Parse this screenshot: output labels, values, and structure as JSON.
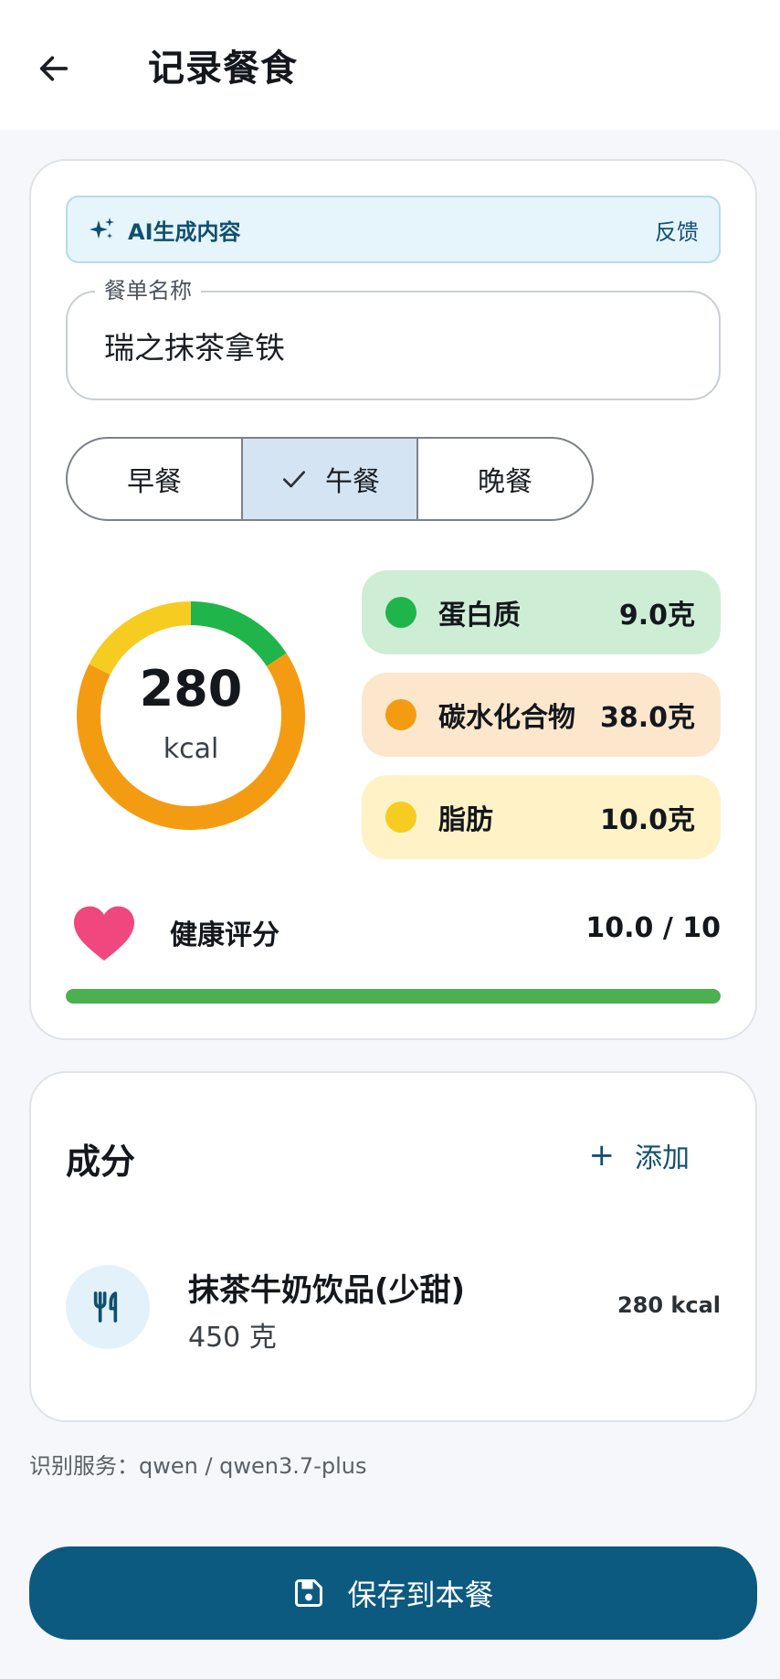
{
  "header": {
    "title": "记录餐食",
    "back_icon": "arrow-left-icon"
  },
  "ai_banner": {
    "label": "AI生成内容",
    "feedback": "反馈",
    "icon": "sparkle-icon"
  },
  "meal_name": {
    "legend": "餐单名称",
    "value": "瑞之抹茶拿铁"
  },
  "meal_type": {
    "options": [
      "早餐",
      "午餐",
      "晚餐"
    ],
    "selected": "午餐"
  },
  "calories": {
    "value": "280",
    "unit": "kcal"
  },
  "macros": [
    {
      "name": "蛋白质",
      "value": "9.0克",
      "grams": 9.0,
      "color": "#1fb54a",
      "bg": "#cdeed5"
    },
    {
      "name": "碳水化合物",
      "value": "38.0克",
      "grams": 38.0,
      "color": "#f39c12",
      "bg": "#fde7cc"
    },
    {
      "name": "脂肪",
      "value": "10.0克",
      "grams": 10.0,
      "color": "#f7cc21",
      "bg": "#fff2c6"
    }
  ],
  "health": {
    "label": "健康评分",
    "score_text": "10.0 / 10",
    "score": 10.0,
    "max": 10,
    "bar_color": "#4caf50",
    "icon": "heart-icon"
  },
  "ingredients": {
    "title": "成分",
    "add_label": "添加",
    "items": [
      {
        "name": "抹茶牛奶饮品(少甜)",
        "quantity": "450 克",
        "kcal": "280 kcal",
        "icon": "utensils-icon"
      }
    ]
  },
  "service": "识别服务：qwen / qwen3.7-plus",
  "save": {
    "label": "保存到本餐",
    "icon": "save-icon"
  }
}
